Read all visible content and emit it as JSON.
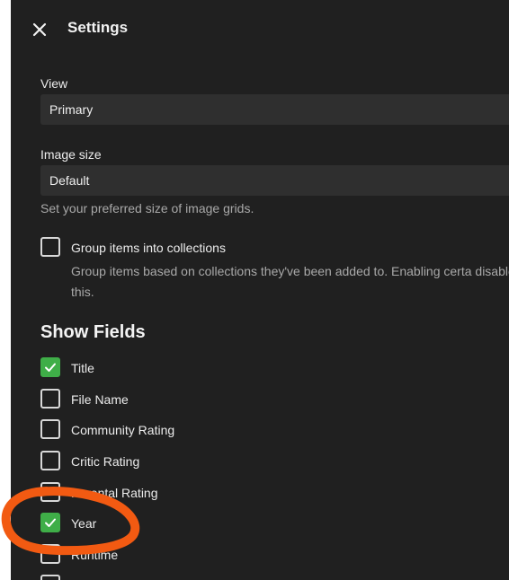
{
  "header": {
    "close_icon": "close-icon",
    "title": "Settings"
  },
  "view": {
    "label": "View",
    "value": "Primary"
  },
  "image_size": {
    "label": "Image size",
    "value": "Default",
    "help": "Set your preferred size of image grids."
  },
  "group_collections": {
    "label": "Group items into collections",
    "checked": false,
    "description": "Group items based on collections they've been added to. Enabling certa disable this."
  },
  "show_fields": {
    "title": "Show Fields",
    "items": [
      {
        "label": "Title",
        "checked": true
      },
      {
        "label": "File Name",
        "checked": false
      },
      {
        "label": "Community Rating",
        "checked": false
      },
      {
        "label": "Critic Rating",
        "checked": false
      },
      {
        "label": "Parental Rating",
        "checked": false
      },
      {
        "label": "Year",
        "checked": true
      },
      {
        "label": "Runtime",
        "checked": false
      }
    ]
  },
  "colors": {
    "panel_bg": "#202020",
    "select_bg": "#2f2f2f",
    "check_green": "#3fae48",
    "annotation_orange": "#f25a12"
  }
}
